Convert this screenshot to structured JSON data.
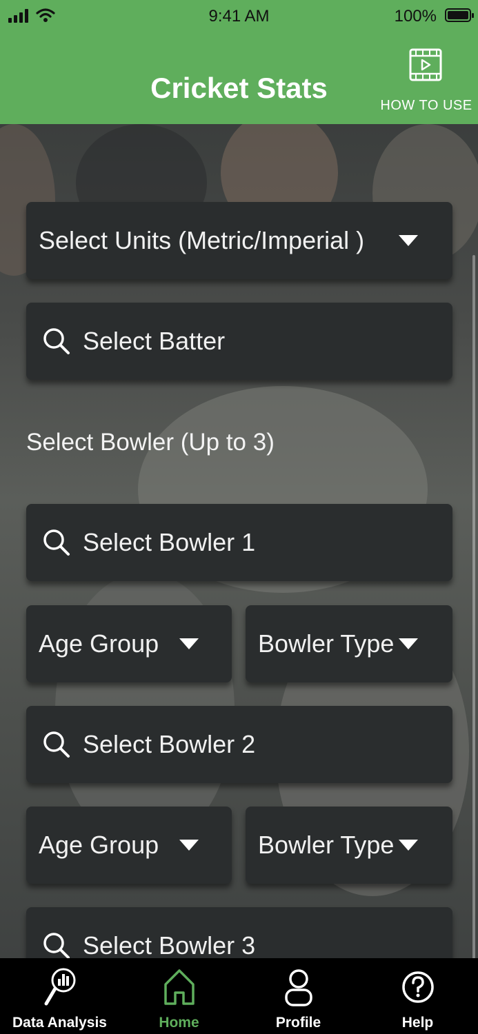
{
  "status": {
    "time": "9:41 AM",
    "battery": "100%"
  },
  "header": {
    "title": "Cricket Stats",
    "how_to_use": "HOW TO USE"
  },
  "form": {
    "units_select": "Select Units (Metric/Imperial )",
    "batter_search": "Select Batter",
    "bowler_section_label": "Select Bowler (Up to 3)",
    "bowlers": [
      {
        "search": "Select Bowler 1",
        "age_group": "Age Group",
        "bowler_type": "Bowler Type"
      },
      {
        "search": "Select Bowler 2",
        "age_group": "Age Group",
        "bowler_type": "Bowler Type"
      },
      {
        "search": "Select Bowler 3"
      }
    ]
  },
  "tabs": [
    {
      "label": "Data Analysis",
      "icon": "data-analysis-icon"
    },
    {
      "label": "Home",
      "icon": "home-icon",
      "active": true
    },
    {
      "label": "Profile",
      "icon": "profile-icon"
    },
    {
      "label": "Help",
      "icon": "help-icon"
    }
  ],
  "colors": {
    "brand_green": "#5fae5c",
    "field_bg": "#2a2d2e",
    "tabbar_bg": "#000000"
  }
}
